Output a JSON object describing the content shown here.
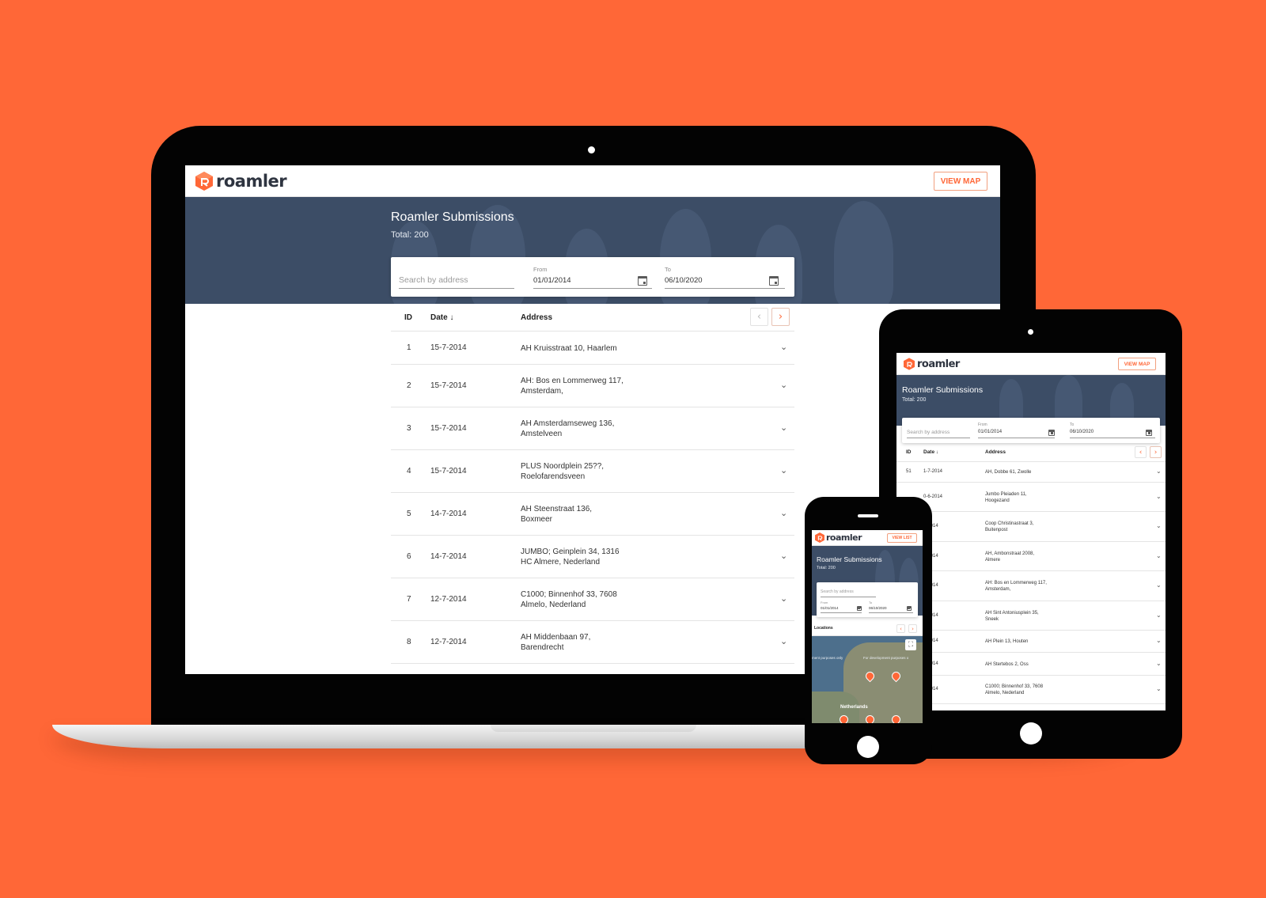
{
  "brand": {
    "name": "roamler",
    "accent": "#ff6737",
    "hero_bg": "#3c4d66"
  },
  "laptop": {
    "header": {
      "view_map_label": "VIEW MAP"
    },
    "hero": {
      "title": "Roamler Submissions",
      "total": "Total: 200"
    },
    "filters": {
      "search_placeholder": "Search by address",
      "from_label": "From",
      "from_value": "01/01/2014",
      "to_label": "To",
      "to_value": "06/10/2020"
    },
    "table": {
      "headers": {
        "id": "ID",
        "date": "Date",
        "address": "Address"
      },
      "rows": [
        {
          "id": "1",
          "date": "15-7-2014",
          "addr1": "AH Kruisstraat 10, Haarlem",
          "addr2": ""
        },
        {
          "id": "2",
          "date": "15-7-2014",
          "addr1": "AH: Bos en Lommerweg 117,",
          "addr2": "Amsterdam,"
        },
        {
          "id": "3",
          "date": "15-7-2014",
          "addr1": "AH Amsterdamseweg 136,",
          "addr2": "Amstelveen"
        },
        {
          "id": "4",
          "date": "15-7-2014",
          "addr1": "PLUS Noordplein 25??,",
          "addr2": "Roelofarendsveen"
        },
        {
          "id": "5",
          "date": "14-7-2014",
          "addr1": "AH Steenstraat 136,",
          "addr2": "Boxmeer"
        },
        {
          "id": "6",
          "date": "14-7-2014",
          "addr1": "JUMBO; Geinplein 34, 1316",
          "addr2": "HC Almere, Nederland"
        },
        {
          "id": "7",
          "date": "12-7-2014",
          "addr1": "C1000; Binnenhof 33, 7608",
          "addr2": "Almelo, Nederland"
        },
        {
          "id": "8",
          "date": "12-7-2014",
          "addr1": "AH Middenbaan 97,",
          "addr2": "Barendrecht"
        }
      ]
    }
  },
  "tablet": {
    "header": {
      "view_map_label": "VIEW MAP"
    },
    "hero": {
      "title": "Roamler Submissions",
      "total": "Total: 200"
    },
    "filters": {
      "search_placeholder": "Search by address",
      "from_label": "From",
      "from_value": "01/01/2014",
      "to_label": "To",
      "to_value": "06/10/2020"
    },
    "table": {
      "headers": {
        "id": "ID",
        "date": "Date",
        "address": "Address"
      },
      "rows": [
        {
          "id": "51",
          "date": "1-7-2014",
          "addr1": "AH, Dobbe 61, Zwolle",
          "addr2": ""
        },
        {
          "id": "",
          "date": "0-6-2014",
          "addr1": "Jumbo Pleiaden 11,",
          "addr2": "Hoogezand"
        },
        {
          "id": "",
          "date": "6-2014",
          "addr1": "Coop Christinastraat 3,",
          "addr2": "Buitenpost"
        },
        {
          "id": "",
          "date": "6-2014",
          "addr1": "AH, Ambonstraat 2008,",
          "addr2": "Almere"
        },
        {
          "id": "",
          "date": "6-2014",
          "addr1": "AH: Bos en Lommerweg 117,",
          "addr2": "Amsterdam,"
        },
        {
          "id": "",
          "date": "6-2014",
          "addr1": "AH Sint Antoniusplein 35,",
          "addr2": "Sneek"
        },
        {
          "id": "",
          "date": "6-2014",
          "addr1": "AH Plein 13, Houten",
          "addr2": ""
        },
        {
          "id": "",
          "date": "6-2014",
          "addr1": "AH Stertebos 2, Oss",
          "addr2": ""
        },
        {
          "id": "",
          "date": "6-2014",
          "addr1": "C1000; Binnenhof 33, 7608",
          "addr2": "Almelo, Nederland"
        }
      ]
    }
  },
  "phone": {
    "header": {
      "view_list_label": "VIEW LIST"
    },
    "hero": {
      "title": "Roamler Submissions",
      "total": "Total: 200"
    },
    "filters": {
      "search_placeholder": "Search by address",
      "from_label": "From",
      "from_value": "01/01/2014",
      "to_label": "To",
      "to_value": "06/10/2020"
    },
    "locations_label": "Locations",
    "map": {
      "country_label": "Netherlands",
      "note_left": "ment purposes only",
      "note_right": "For development purposes o"
    }
  }
}
